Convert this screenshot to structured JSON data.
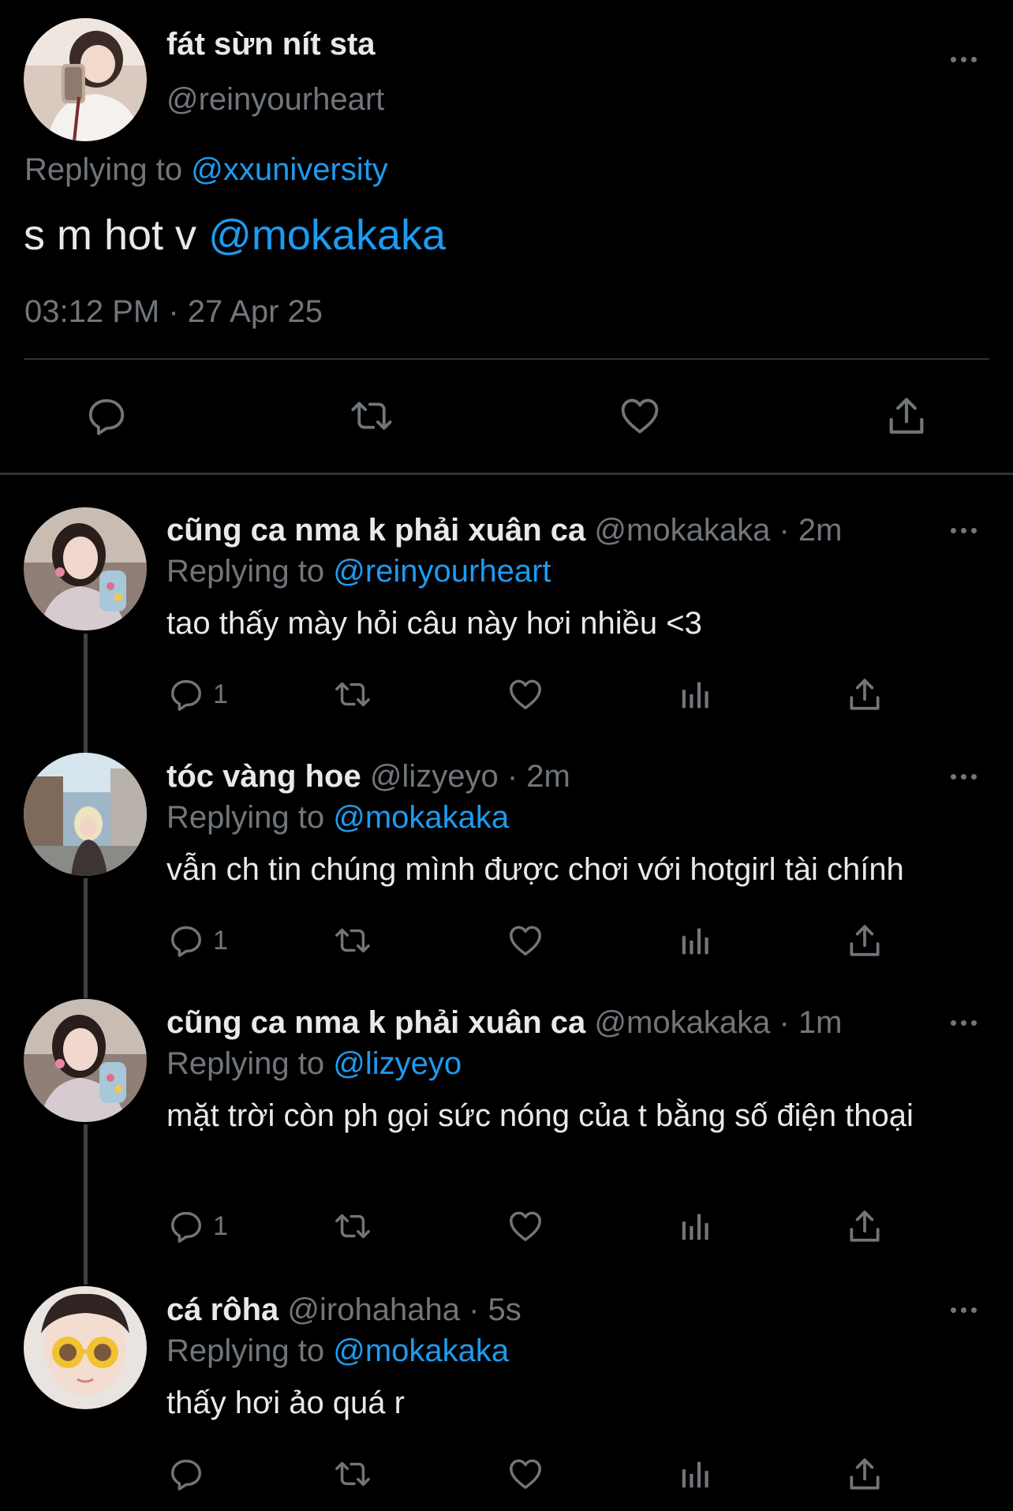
{
  "main_tweet": {
    "display_name": "fát sừn nít sta",
    "handle": "@reinyourheart",
    "replying_label": "Replying to",
    "replying_to": "@xxuniversity",
    "text": "s m hot v",
    "text_mention": "@mokakaka",
    "timestamp": "03:12 PM · 27 Apr 25",
    "actions": [
      "reply-icon",
      "retweet-icon",
      "like-icon",
      "share-icon"
    ]
  },
  "replies": [
    {
      "display_name": "cũng ca nma k phải xuân ca",
      "handle": "@mokakaka",
      "time": "· 2m",
      "replying_label": "Replying to",
      "replying_to": "@reinyourheart",
      "text": "tao thấy mày hỏi câu này hơi nhiều <3",
      "reply_count": "1"
    },
    {
      "display_name": "tóc vàng hoe",
      "handle": "@lizyeyo",
      "time": "· 2m",
      "replying_label": "Replying to",
      "replying_to": "@mokakaka",
      "text": "vẫn ch tin chúng mình được chơi với hotgirl tài chính",
      "reply_count": "1"
    },
    {
      "display_name": "cũng ca nma k phải xuân ca",
      "handle": "@mokakaka",
      "time": "· 1m",
      "replying_label": "Replying to",
      "replying_to": "@lizyeyo",
      "text": "mặt trời còn ph gọi sức nóng của t bằng số điện thoại",
      "reply_count": "1"
    },
    {
      "display_name": "cá rôha",
      "handle": "@irohahaha",
      "time": "· 5s",
      "replying_label": "Replying to",
      "replying_to": "@mokakaka",
      "text": "thấy hơi ảo quá r",
      "reply_count": ""
    }
  ],
  "colors": {
    "background": "#000000",
    "text": "#e7e9ea",
    "muted": "#71767b",
    "link": "#1d9bf0",
    "divider": "#2f3336"
  }
}
